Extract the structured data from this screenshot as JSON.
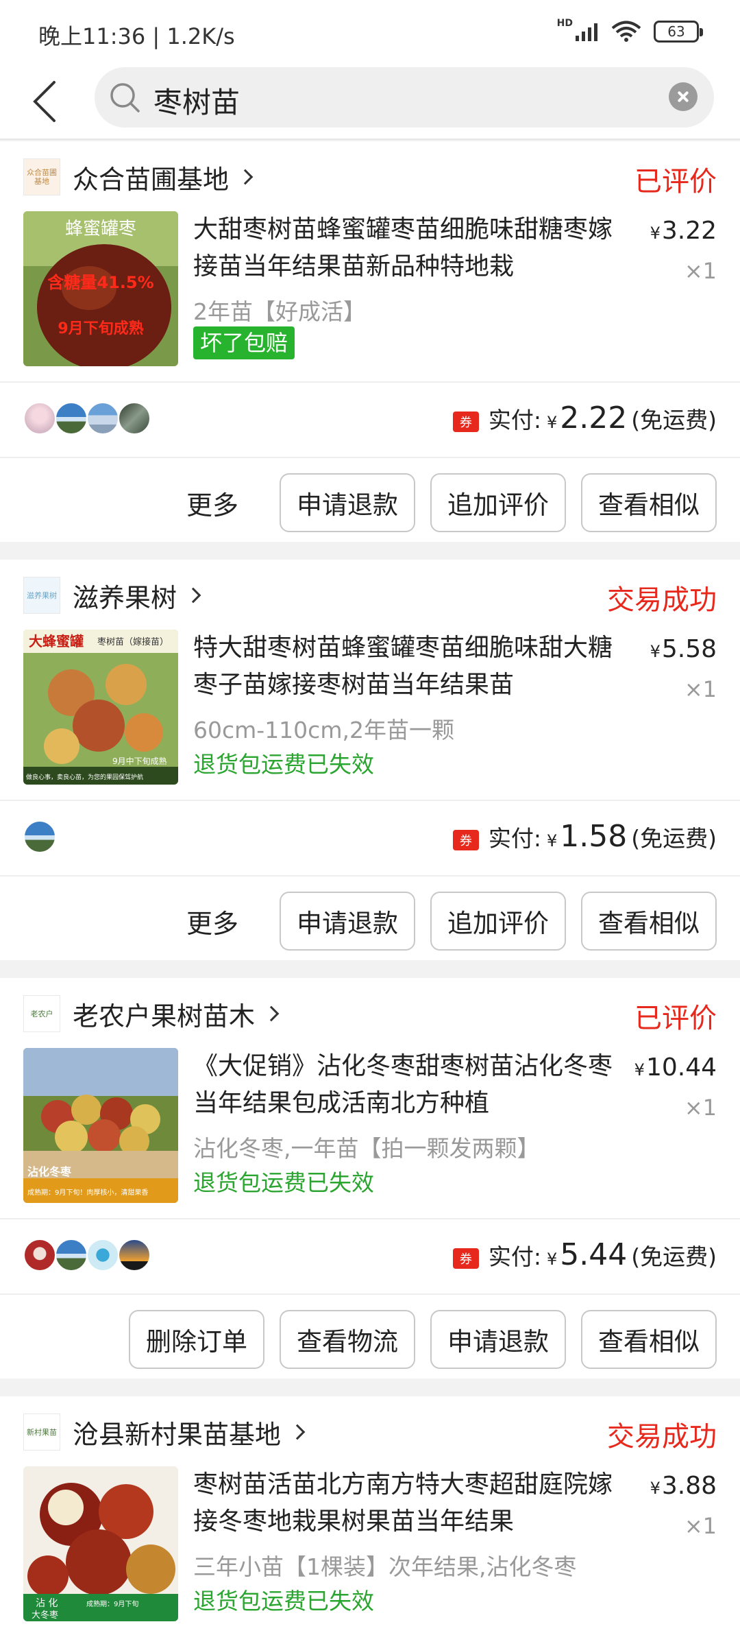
{
  "status_bar": {
    "time": "晚上11:36 | 1.2K/s",
    "network": "HD",
    "battery": "63"
  },
  "search": {
    "query": "枣树苗"
  },
  "orders": [
    {
      "shop": "众合苗圃基地",
      "shop_logo": "众合苗圃基地",
      "status": "已评价",
      "title": "大甜枣树苗蜂蜜罐枣苗细脆味甜糖枣嫁接苗当年结果苗新品种特地栽",
      "price_symbol": "¥",
      "price": "3.22",
      "qty": "×1",
      "spec": "2年苗【好成活】",
      "tag": "坏了包赔",
      "pay_label": "实付:",
      "pay_amount": "2.22",
      "shipping": "(免运费)",
      "coupon": "券",
      "more": "更多",
      "buttons": [
        "申请退款",
        "追加评价",
        "查看相似"
      ],
      "thumb_text": [
        "蜂蜜罐枣",
        "含糖量41.5%",
        "9月下旬成熟"
      ]
    },
    {
      "shop": "滋养果树",
      "shop_logo": "滋养果树",
      "status": "交易成功",
      "title": "特大甜枣树苗蜂蜜罐枣苗细脆味甜大糖枣子苗嫁接枣树苗当年结果苗",
      "price_symbol": "¥",
      "price": "5.58",
      "qty": "×1",
      "spec": "60cm-110cm,2年苗一颗",
      "note": "退货包运费已失效",
      "pay_label": "实付:",
      "pay_amount": "1.58",
      "shipping": "(免运费)",
      "coupon": "券",
      "more": "更多",
      "buttons": [
        "申请退款",
        "追加评价",
        "查看相似"
      ],
      "thumb_text": [
        "大蜂蜜罐",
        "枣树苗（嫁接苗）",
        "9月中下旬成熟",
        "做良心事，卖良心苗，为您的果园保驾护航"
      ]
    },
    {
      "shop": "老农户果树苗木",
      "shop_logo": "老农户",
      "status": "已评价",
      "title": "《大促销》沾化冬枣甜枣树苗沾化冬枣当年结果包成活南北方种植",
      "price_symbol": "¥",
      "price": "10.44",
      "qty": "×1",
      "spec": "沾化冬枣,一年苗【拍一颗发两颗】",
      "note": "退货包运费已失效",
      "pay_label": "实付:",
      "pay_amount": "5.44",
      "shipping": "(免运费)",
      "coupon": "券",
      "buttons": [
        "删除订单",
        "查看物流",
        "申请退款",
        "查看相似"
      ],
      "thumb_text": [
        "沾化冬枣",
        "成熟期：9月下旬！肉厚核小，清甜果香"
      ]
    },
    {
      "shop": "沧县新村果苗基地",
      "shop_logo": "新村果苗",
      "status": "交易成功",
      "title": "枣树苗活苗北方南方特大枣超甜庭院嫁接冬枣地栽果树果苗当年结果",
      "price_symbol": "¥",
      "price": "3.88",
      "qty": "×1",
      "spec": "三年小苗【1棵装】次年结果,沾化冬枣",
      "note": "退货包运费已失效",
      "thumb_text": [
        "沾 化",
        "大冬枣",
        "成熟期：9月下旬"
      ]
    }
  ],
  "colors": {
    "accent_red": "#e6291c",
    "green": "#2aa52f",
    "tag_green": "#27b32d"
  }
}
